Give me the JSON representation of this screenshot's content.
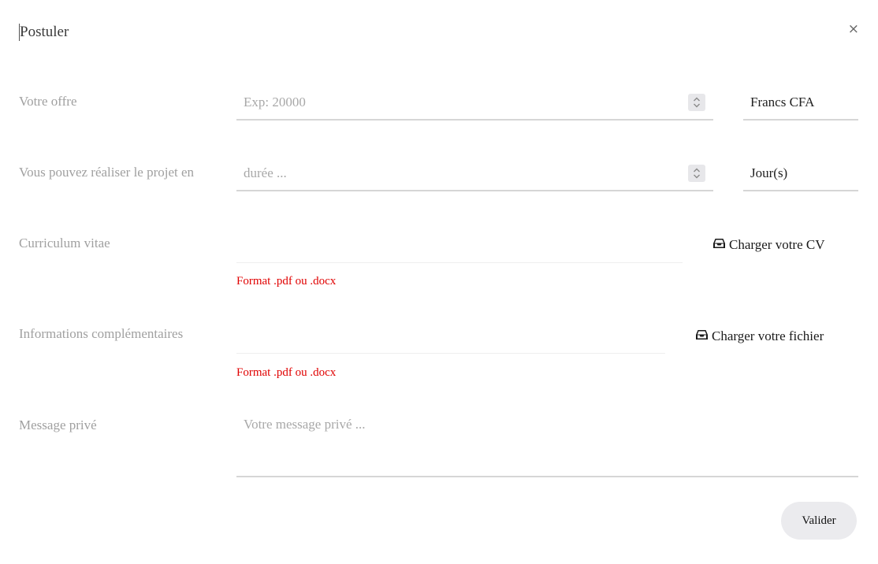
{
  "modal": {
    "title": "Postuler",
    "close_symbol": "×"
  },
  "offer": {
    "label": "Votre offre",
    "placeholder": "Exp: 20000",
    "currency": "Francs CFA"
  },
  "duration": {
    "label": "Vous pouvez réaliser le projet en",
    "placeholder": "durée ...",
    "unit": "Jour(s)"
  },
  "cv": {
    "label": "Curriculum vitae",
    "button_label": "Charger votre CV",
    "button_icon": "inbox-icon",
    "hint": "Format .pdf ou .docx"
  },
  "extra_info": {
    "label": "Informations complémentaires",
    "button_label": "Charger votre fichier",
    "button_icon": "inbox-icon",
    "hint": "Format .pdf ou .docx"
  },
  "message": {
    "label": "Message privé",
    "placeholder": "Votre message privé ..."
  },
  "actions": {
    "submit_label": "Valider"
  },
  "colors": {
    "error": "#e00000",
    "label": "#a0a0a0",
    "button_bg": "#ebebee"
  }
}
